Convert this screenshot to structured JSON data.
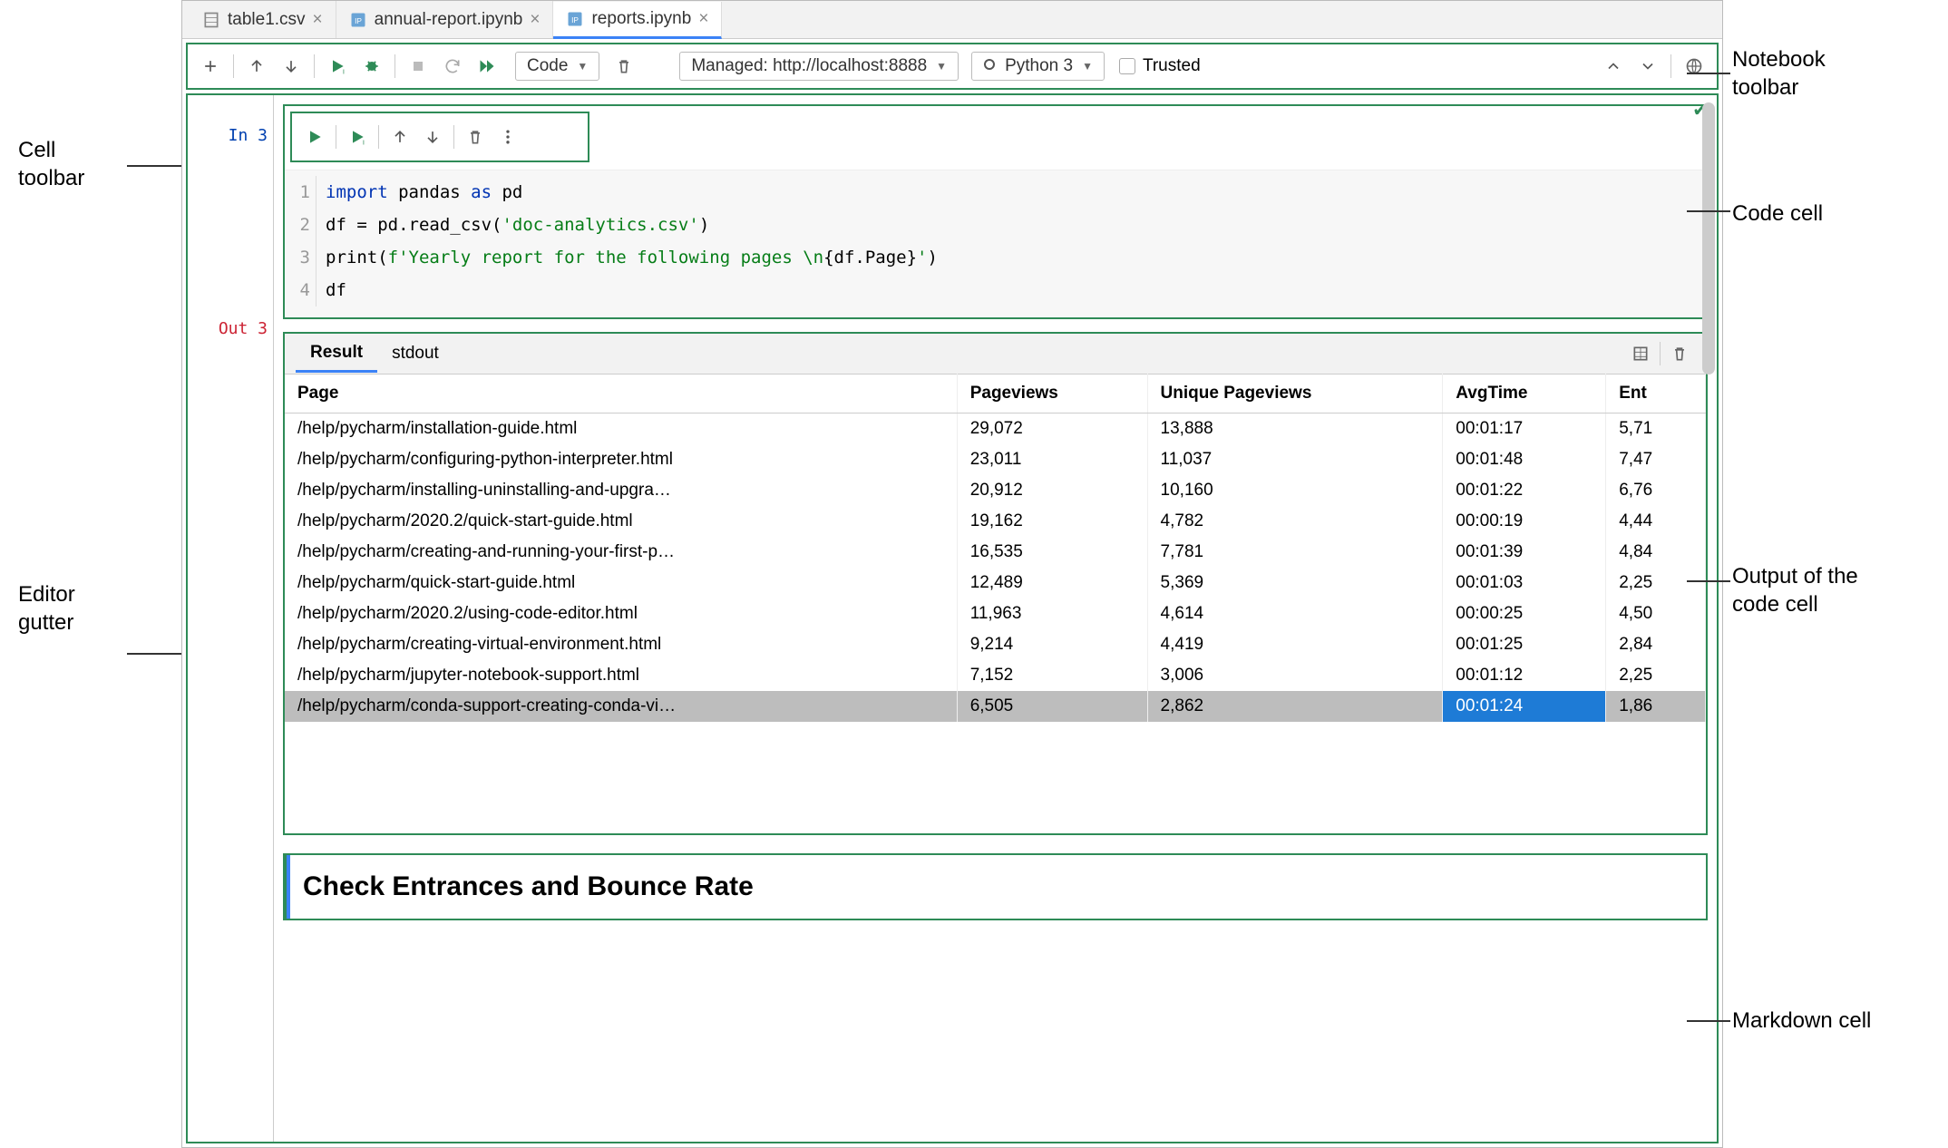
{
  "tabs": [
    {
      "label": "table1.csv",
      "icon": "csv"
    },
    {
      "label": "annual-report.ipynb",
      "icon": "ipynb"
    },
    {
      "label": "reports.ipynb",
      "icon": "ipynb",
      "active": true
    }
  ],
  "toolbar": {
    "cell_type": "Code",
    "server": "Managed: http://localhost:8888",
    "kernel": "Python 3",
    "trusted_label": "Trusted"
  },
  "annotations": {
    "cell_toolbar": "Cell\ntoolbar",
    "editor_gutter": "Editor\ngutter",
    "notebook_toolbar": "Notebook\ntoolbar",
    "code_cell": "Code cell",
    "output": "Output of the\ncode cell",
    "markdown_cell": "Markdown cell"
  },
  "cell": {
    "in_label": "In 3",
    "out_label": "Out 3",
    "lines": [
      "1",
      "2",
      "3",
      "4"
    ],
    "code_html": "<span class='kw'>import</span> pandas <span class='kw'>as</span> pd\ndf = pd.read_csv(<span class='str'>'doc-analytics.csv'</span>)\nprint(<span class='str'>f'Yearly report for the following pages \\n</span>{df.Page}<span class='str'>'</span>)\ndf"
  },
  "output": {
    "tabs": {
      "result": "Result",
      "stdout": "stdout"
    },
    "columns": [
      "Page",
      "Pageviews",
      "Unique Pageviews",
      "AvgTime",
      "Ent"
    ],
    "rows": [
      {
        "page": "/help/pycharm/installation-guide.html",
        "pv": "29,072",
        "upv": "13,888",
        "avg": "00:01:17",
        "ent": "5,71"
      },
      {
        "page": "/help/pycharm/configuring-python-interpreter.html",
        "pv": "23,011",
        "upv": "11,037",
        "avg": "00:01:48",
        "ent": "7,47"
      },
      {
        "page": "/help/pycharm/installing-uninstalling-and-upgra…",
        "pv": "20,912",
        "upv": "10,160",
        "avg": "00:01:22",
        "ent": "6,76"
      },
      {
        "page": "/help/pycharm/2020.2/quick-start-guide.html",
        "pv": "19,162",
        "upv": "4,782",
        "avg": "00:00:19",
        "ent": "4,44"
      },
      {
        "page": "/help/pycharm/creating-and-running-your-first-p…",
        "pv": "16,535",
        "upv": "7,781",
        "avg": "00:01:39",
        "ent": "4,84"
      },
      {
        "page": "/help/pycharm/quick-start-guide.html",
        "pv": "12,489",
        "upv": "5,369",
        "avg": "00:01:03",
        "ent": "2,25"
      },
      {
        "page": "/help/pycharm/2020.2/using-code-editor.html",
        "pv": "11,963",
        "upv": "4,614",
        "avg": "00:00:25",
        "ent": "4,50"
      },
      {
        "page": "/help/pycharm/creating-virtual-environment.html",
        "pv": "9,214",
        "upv": "4,419",
        "avg": "00:01:25",
        "ent": "2,84"
      },
      {
        "page": "/help/pycharm/jupyter-notebook-support.html",
        "pv": "7,152",
        "upv": "3,006",
        "avg": "00:01:12",
        "ent": "2,25"
      },
      {
        "page": "/help/pycharm/conda-support-creating-conda-vi…",
        "pv": "6,505",
        "upv": "2,862",
        "avg": "00:01:24",
        "ent": "1,86",
        "selected": true
      }
    ]
  },
  "markdown": {
    "heading": "Check Entrances and Bounce Rate"
  }
}
